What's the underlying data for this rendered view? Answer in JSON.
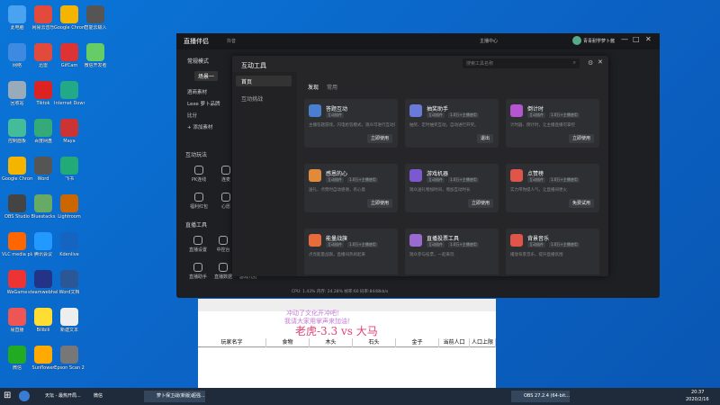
{
  "desktop_icons": [
    {
      "label": "此电脑",
      "color": "#4aa3f0"
    },
    {
      "label": "网易云音乐",
      "color": "#e24a3b"
    },
    {
      "label": "Google Chrome",
      "color": "#f4b400"
    },
    {
      "label": "智能云输入",
      "color": "#555"
    },
    {
      "label": "网络",
      "color": "#3d8ae0"
    },
    {
      "label": "迅雷",
      "color": "#e24a3b"
    },
    {
      "label": "GifCam",
      "color": "#d33"
    },
    {
      "label": "微信开发者",
      "color": "#6c6"
    },
    {
      "label": "回收站",
      "color": "#9ab"
    },
    {
      "label": "Tiktok",
      "color": "#d22"
    },
    {
      "label": "Internet Downlo",
      "color": "#2a8"
    },
    {
      "label": "",
      "color": "#000"
    },
    {
      "label": "控制面板",
      "color": "#4b9"
    },
    {
      "label": "百度网盘",
      "color": "#3a7"
    },
    {
      "label": "Maya",
      "color": "#c33"
    },
    {
      "label": "",
      "color": "#000"
    },
    {
      "label": "Google Chrome",
      "color": "#f4b400"
    },
    {
      "label": "Word",
      "color": "#555"
    },
    {
      "label": "飞书",
      "color": "#2a7"
    },
    {
      "label": "",
      "color": "#000"
    },
    {
      "label": "OBS Studio",
      "color": "#444"
    },
    {
      "label": "Bluestacks",
      "color": "#6a6"
    },
    {
      "label": "Lightroom",
      "color": "#c60"
    },
    {
      "label": "",
      "color": "#000"
    },
    {
      "label": "VLC media player",
      "color": "#f60"
    },
    {
      "label": "腾讯会议",
      "color": "#29f"
    },
    {
      "label": "Kdenlive",
      "color": "#1565c0"
    },
    {
      "label": "",
      "color": "#000"
    },
    {
      "label": "WeGame",
      "color": "#e33"
    },
    {
      "label": "steamwebhelper",
      "color": "#238"
    },
    {
      "label": "Word文档",
      "color": "#2b5797"
    },
    {
      "label": "",
      "color": "#000"
    },
    {
      "label": "易直播",
      "color": "#e55"
    },
    {
      "label": "Bilibili",
      "color": "#fd3"
    },
    {
      "label": "新建文本",
      "color": "#eee"
    },
    {
      "label": "",
      "color": "#000"
    },
    {
      "label": "微信",
      "color": "#2a2"
    },
    {
      "label": "Sunflower",
      "color": "#fa0"
    },
    {
      "label": "Epson Scan 2",
      "color": "#777"
    },
    {
      "label": "",
      "color": "#000"
    }
  ],
  "app": {
    "title": "直播伴侣",
    "subtitle": "抖音",
    "header_status": "主播中心",
    "user": "青青耐学萝卜酱",
    "mode": "常规模式",
    "scene": "场景一",
    "left_items": [
      "酒商素材",
      "Lexe 萝卜品牌",
      "比分",
      "+ 添加素材"
    ],
    "section_interact": "互动玩法",
    "interact_items": [
      "PK连线",
      "连麦",
      "福利红包",
      "心愿"
    ],
    "section_tools": "直播工具",
    "tool_items": [
      "直播设置",
      "中控台",
      "互动工具",
      "直播助手",
      "直播数据",
      "游戏代打"
    ]
  },
  "modal": {
    "title": "互动工具",
    "search_placeholder": "搜索工具名称",
    "nav": [
      "首页",
      "互动挑战"
    ],
    "tabs": [
      "发现",
      "常用"
    ],
    "cards": [
      {
        "title": "答题互动",
        "tag": "互动插件",
        "tag2": "",
        "desc": "主播答题游戏，闪电抢答模式，观众可进行互动答题",
        "btn": "立即使用",
        "color": "#4a7fd0"
      },
      {
        "title": "抽奖助手",
        "tag": "互动插件",
        "tag2": "1.0万+主播使用",
        "desc": "抽奖、定时抽奖互动，自动进行开奖。",
        "btn": "退出",
        "color": "#6a7ad8"
      },
      {
        "title": "倒计时",
        "tag": "互动插件",
        "tag2": "1.0万+主播使用",
        "desc": "计时器、倒计时，让主播直播可掌控",
        "btn": "立即使用",
        "color": "#b556d0"
      },
      {
        "title": "感恩的心",
        "tag": "互动插件",
        "tag2": "1.0万+主播使用",
        "desc": "送礼、点赞时自动感谢，有心意",
        "btn": "立即使用",
        "color": "#e08a3a"
      },
      {
        "title": "游戏机器",
        "tag": "互动插件",
        "tag2": "1.0万+主播使用",
        "desc": "观众送礼物加时间，增加互动时长",
        "btn": "立即使用",
        "color": "#7b5ad0"
      },
      {
        "title": "点赞榜",
        "tag": "互动插件",
        "tag2": "1.0万+主播使用",
        "desc": "实力带你提人气，让直播间更火",
        "btn": "免费试用",
        "color": "#e0554a"
      },
      {
        "title": "能量战旗",
        "tag": "互动插件",
        "tag2": "1.0万+主播使用",
        "desc": "点亮能量战旗，直播间热闹起来",
        "btn": "",
        "color": "#e86b3b"
      },
      {
        "title": "直播投票工具",
        "tag": "互动插件",
        "tag2": "1.0万+主播使用",
        "desc": "观众参与投票，一起来玩",
        "btn": "",
        "color": "#9a6ad0"
      },
      {
        "title": "背景音乐",
        "tag": "互动插件",
        "tag2": "1.0万+主播使用",
        "desc": "播放背景音乐，提升直播氛围",
        "btn": "",
        "color": "#e0554a"
      }
    ]
  },
  "stats_bar": {
    "text": "CPU: 1.43%  内存: 24.28%  帧率:60  码率:8448kb/s"
  },
  "spreadsheet": {
    "overlay1": "冲动了文化开冲吧！",
    "overlay2": "我请大家用掌声来加油！",
    "big_text": "老虎-3.3 vs  大马",
    "headers": [
      "玩家名字",
      "食物",
      "木头",
      "石头",
      "金子",
      "当前人口",
      "人口上限"
    ]
  },
  "taskbar": {
    "items": [
      "天坛 - 最热开局...",
      "微信",
      "萝卜保卫战(新版)超强..."
    ],
    "obs": "OBS 27.2.4 (64-bit...",
    "time": "20:37",
    "date": "2020/2/16"
  }
}
